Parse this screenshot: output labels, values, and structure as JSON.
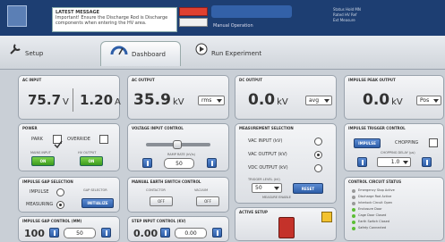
{
  "header": {
    "msg_title": "LATEST MESSAGE",
    "msg_body": "Important! Ensure the Discharge Rod is Discharge components when entering the HV area.",
    "mode_label": "Manual Operation",
    "right_lines": [
      "Status Hold MN",
      "Rated HV Ref",
      "Ext Measure"
    ]
  },
  "tabs": [
    {
      "label": "Setup"
    },
    {
      "label": "Dashboard"
    },
    {
      "label": "Run Experiment"
    }
  ],
  "ac_input": {
    "title": "AC INPUT",
    "volt": "75.7",
    "volt_unit": "V",
    "amp": "1.20",
    "amp_unit": "A"
  },
  "ac_output": {
    "title": "AC OUTPUT",
    "value": "35.9",
    "unit": "kV",
    "mode": "rms"
  },
  "dc_output": {
    "title": "DC OUTPUT",
    "value": "0.0",
    "unit": "kV",
    "mode": "avg"
  },
  "impulse_peak": {
    "title": "IMPULSE PEAK OUTPUT",
    "value": "0.0",
    "unit": "kV",
    "mode": "Pos"
  },
  "power": {
    "title": "POWER",
    "park": "PARK",
    "override": "OVERRIDE",
    "mains_label": "MAINS INPUT",
    "mains_led": "ON",
    "hv_label": "HV OUTPUT",
    "hv_led": "ON"
  },
  "voltage_input": {
    "title": "VOLTAGE INPUT CONTROL",
    "sub": "RAMP RATE (kV/s)",
    "value": "50"
  },
  "measurement": {
    "title": "MEASUREMENT SELECTION",
    "vac": "VAC INPUT (kV)",
    "vacout": "VAC OUTPUT (kV)",
    "vdc": "VDC OUTPUT (kV)",
    "sub": "TRIGGER LEVEL (kV)",
    "value": "50",
    "reset": "RESET",
    "sub2": "MEASURE ENABLE"
  },
  "impulse_trigger": {
    "title": "IMPULSE TRIGGER CONTROL",
    "impulse_btn": "IMPULSE",
    "chopping": "CHOPPING",
    "sub": "CHOPPING DELAY (µs)",
    "value": "1.0"
  },
  "impulse_gap": {
    "title": "IMPULSE GAP SELECTION",
    "impulse": "IMPULSE",
    "measuring": "MEASURING",
    "sub": "GAP SELECTOR",
    "btn": "INITIALIZE"
  },
  "manual_earth": {
    "title": "MANUAL EARTH SWITCH CONTROL",
    "left": "CONTACTOR",
    "right": "VACUUM",
    "off1": "OFF",
    "off2": "OFF"
  },
  "impulse_gap_control": {
    "title": "IMPULSE GAP CONTROL (mm)",
    "left": "100",
    "mid": "50"
  },
  "stepper": {
    "title": "STEP INPUT CONTROL (kV)",
    "left": "0.00",
    "mid": "0.00"
  },
  "active_setup": {
    "title": "ACTIVE SETUP"
  },
  "control_status": {
    "title": "CONTROL CIRCUIT STATUS",
    "items": [
      "Emergency Stop Active",
      "Discharge Rod Active",
      "Interlock Circuit Open",
      "Enclosure Door",
      "Cage Door Closed",
      "Earth Switch Closed",
      "Safety Connected"
    ]
  }
}
